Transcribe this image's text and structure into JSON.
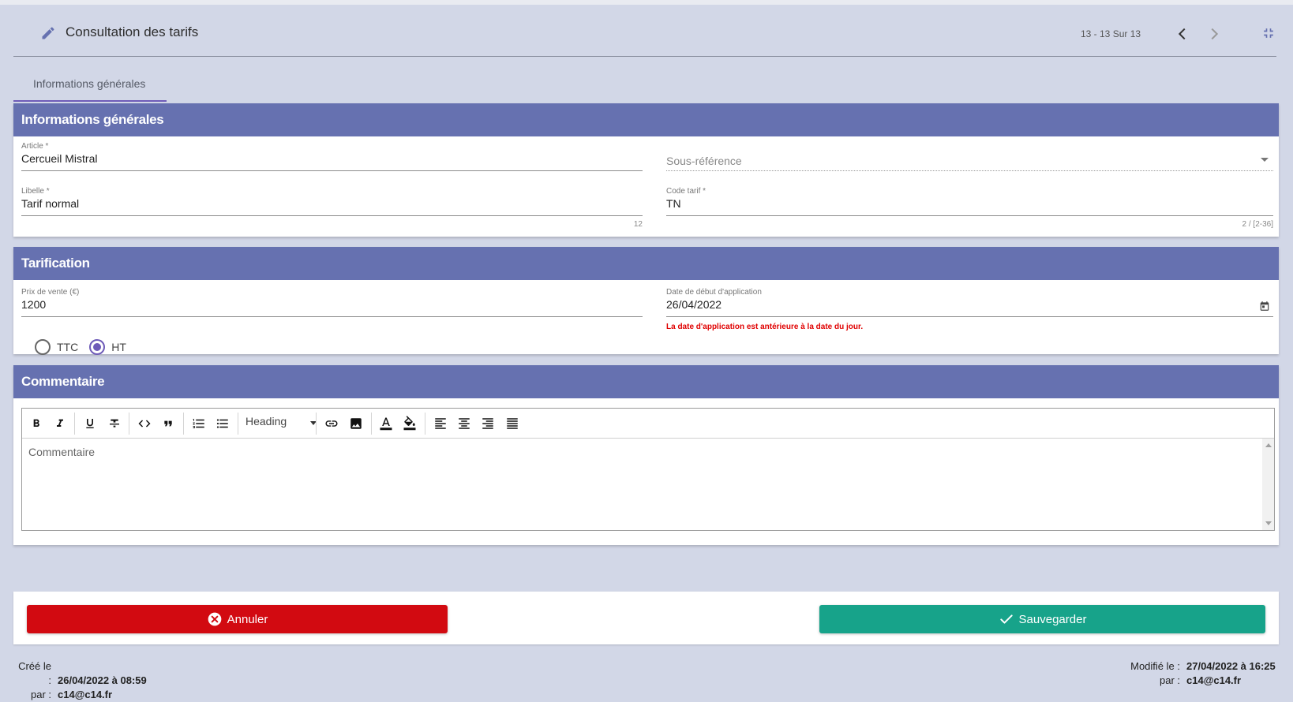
{
  "header": {
    "title": "Consultation des tarifs",
    "pager": "13 - 13 Sur 13"
  },
  "tabs": [
    {
      "label": "Informations générales",
      "active": true
    }
  ],
  "sections": {
    "general": {
      "title": "Informations générales",
      "article": {
        "label": "Article *",
        "value": "Cercueil Mistral"
      },
      "sous_reference": {
        "placeholder": "Sous-référence",
        "value": ""
      },
      "libelle": {
        "label": "Libelle *",
        "value": "Tarif normal",
        "counter": "12"
      },
      "code_tarif": {
        "label": "Code tarif *",
        "value": "TN",
        "counter": "2 / [2-36]"
      }
    },
    "tarification": {
      "title": "Tarification",
      "prix": {
        "label": "Prix de vente (€)",
        "value": "1200"
      },
      "date": {
        "label": "Date de début d'application",
        "value": "26/04/2022",
        "error": "La date d'application est antérieure à la date du jour."
      },
      "radios": [
        {
          "label": "TTC",
          "selected": false
        },
        {
          "label": "HT",
          "selected": true
        }
      ]
    },
    "commentaire": {
      "title": "Commentaire",
      "heading_select": "Heading",
      "placeholder": "Commentaire"
    }
  },
  "actions": {
    "cancel_label": "Annuler",
    "save_label": "Sauvegarder"
  },
  "meta": {
    "created_label": "Créé le :",
    "created_value": "26/04/2022 à 08:59",
    "created_by_label": "par :",
    "created_by_value": "c14@c14.fr",
    "modified_label": "Modifié le :",
    "modified_value": "27/04/2022 à 16:25",
    "modified_by_label": "par :",
    "modified_by_value": "c14@c14.fr"
  },
  "colors": {
    "accent": "#6e5bb8",
    "section_header": "#6671b0",
    "cancel": "#d20a11",
    "save": "#17a38a",
    "error": "#e00000",
    "background": "#d2d7e7"
  },
  "icons": {
    "header": [
      "pencil-icon",
      "chevron-left-icon",
      "chevron-right-icon",
      "collapse-icon"
    ],
    "toolbar": [
      "bold-icon",
      "italic-icon",
      "underline-icon",
      "strikethrough-icon",
      "code-icon",
      "quote-icon",
      "ordered-list-icon",
      "bullet-list-icon",
      "link-icon",
      "image-icon",
      "text-color-icon",
      "fill-color-icon",
      "align-left-icon",
      "align-center-icon",
      "align-right-icon",
      "align-justify-icon"
    ]
  }
}
